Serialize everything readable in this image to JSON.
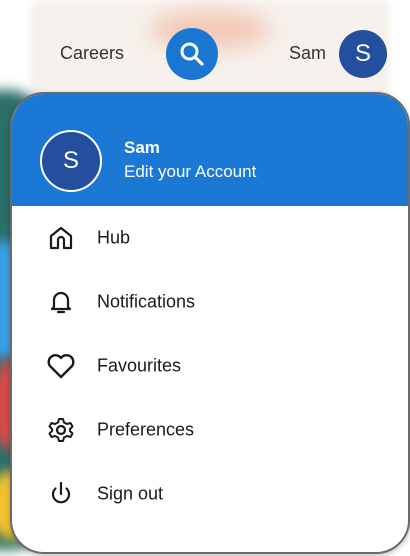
{
  "topbar": {
    "careers_label": "Careers",
    "search_icon": "search-icon",
    "user_name": "Sam",
    "avatar_initial": "S"
  },
  "menu": {
    "header": {
      "avatar_initial": "S",
      "name": "Sam",
      "subtitle": "Edit your Account"
    },
    "items": [
      {
        "label": "Hub",
        "icon": "home-icon"
      },
      {
        "label": "Notifications",
        "icon": "bell-icon"
      },
      {
        "label": "Favourites",
        "icon": "heart-icon"
      },
      {
        "label": "Preferences",
        "icon": "gear-icon"
      },
      {
        "label": "Sign out",
        "icon": "power-icon"
      }
    ]
  },
  "colors": {
    "accent": "#1b78d4",
    "avatar": "#234f9e",
    "search_button": "#1977d2"
  }
}
